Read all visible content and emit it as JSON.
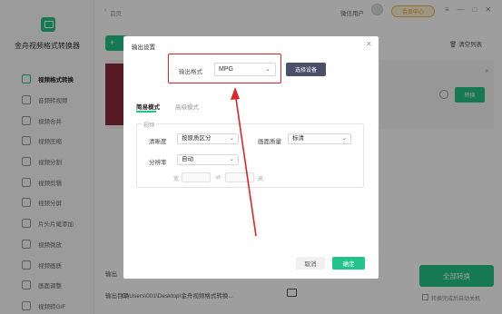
{
  "app": {
    "name": "金舟视频格式转换器",
    "breadcrumb": "首页",
    "user_name": "微信用户",
    "vip_label": "会员中心",
    "window_controls": [
      "≡",
      "—",
      "□",
      "✕"
    ]
  },
  "sidebar": {
    "items": [
      {
        "label": "视频格式转换",
        "icon": "convert-icon",
        "active": true
      },
      {
        "label": "音频转视频",
        "icon": "audio-icon"
      },
      {
        "label": "视频合并",
        "icon": "merge-icon"
      },
      {
        "label": "视频压缩",
        "icon": "compress-icon"
      },
      {
        "label": "视频分割",
        "icon": "split-icon"
      },
      {
        "label": "视频剪辑",
        "icon": "clip-icon"
      },
      {
        "label": "视频分屏",
        "icon": "split-screen-icon"
      },
      {
        "label": "片头片尾添加",
        "icon": "intro-outro-icon"
      },
      {
        "label": "视频倒放",
        "icon": "reverse-icon"
      },
      {
        "label": "视频画质",
        "icon": "quality-icon"
      },
      {
        "label": "画面调整",
        "icon": "adjust-icon"
      },
      {
        "label": "视频转GIF",
        "icon": "gif-icon"
      }
    ]
  },
  "main": {
    "add_label": "+",
    "clear_list": "清空列表",
    "convert_button": "转换",
    "output_label": "输出",
    "output_dir_label": "输出目录",
    "output_path": "C:\\Users\\001\\Desktop\\金舟视频格式转换...",
    "all_convert": "全部转换",
    "shutdown_label": "转换完成后自动关机"
  },
  "dialog": {
    "title": "输出设置",
    "format_label": "输出格式",
    "format_value": "MPG",
    "choose_device": "选择设备",
    "tabs": [
      "简易模式",
      "高级模式"
    ],
    "section_title": "视频",
    "clarity_label": "清晰度",
    "clarity_value": "按原质区分",
    "quality_label": "画面质量",
    "quality_value": "标清",
    "resolution_label": "分辨率",
    "resolution_value": "自动",
    "width_label": "宽",
    "height_label": "高",
    "cancel": "取消",
    "ok": "确定"
  },
  "colors": {
    "accent": "#23c48a",
    "annotation": "#e02424",
    "device_button": "#4a4f6a"
  }
}
